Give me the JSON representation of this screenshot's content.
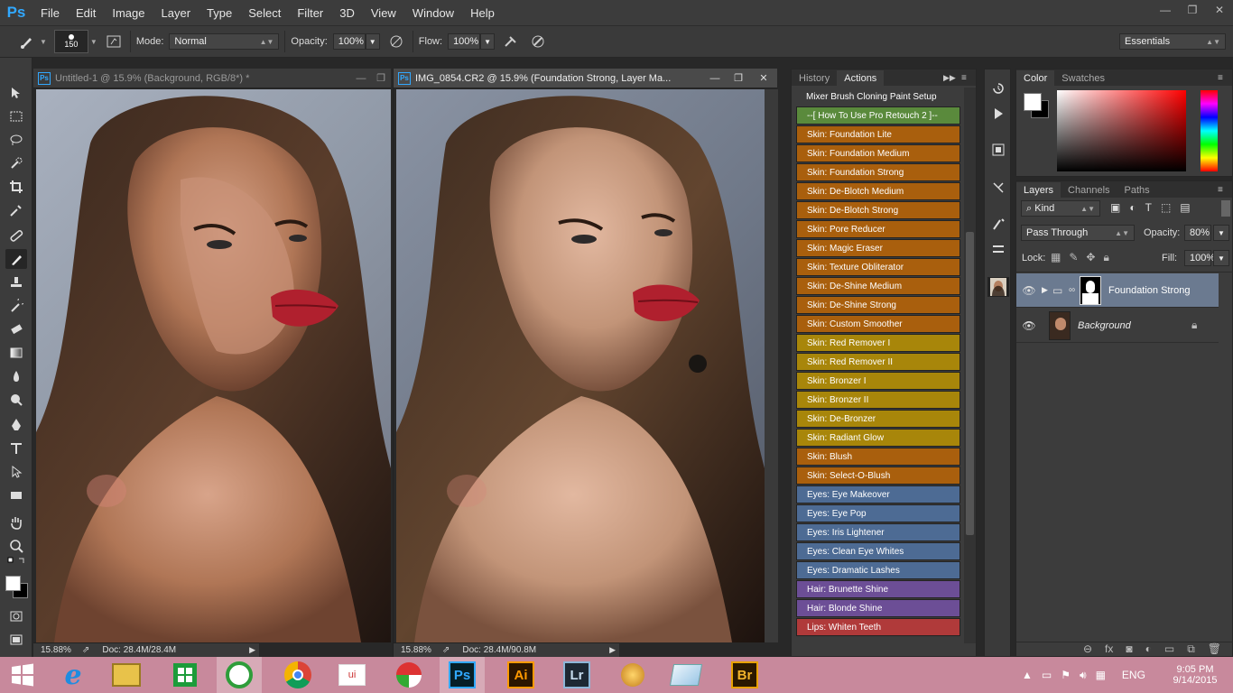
{
  "app": {
    "logo": "Ps"
  },
  "menu": [
    "File",
    "Edit",
    "Image",
    "Layer",
    "Type",
    "Select",
    "Filter",
    "3D",
    "View",
    "Window",
    "Help"
  ],
  "window_controls": {
    "minimize": "—",
    "restore": "❐",
    "close": "✕"
  },
  "options": {
    "brush_size": "150",
    "mode_label": "Mode:",
    "mode_value": "Normal",
    "opacity_label": "Opacity:",
    "opacity_value": "100%",
    "flow_label": "Flow:",
    "flow_value": "100%",
    "workspace": "Essentials"
  },
  "documents": [
    {
      "title": "Untitled-1 @ 15.9% (Background, RGB/8*) *",
      "zoom": "15.88%",
      "doc": "Doc: 28.4M/28.4M"
    },
    {
      "title": "IMG_0854.CR2 @ 15.9% (Foundation Strong, Layer Ma...",
      "zoom": "15.88%",
      "doc": "Doc: 28.4M/90.8M"
    }
  ],
  "actions_panel": {
    "tabs": [
      "History",
      "Actions"
    ],
    "active_tab": "Actions",
    "items": [
      {
        "label": "Mixer Brush Cloning Paint Setup",
        "color": "#3c3c3c"
      },
      {
        "label": "--[ How To Use Pro Retouch 2 ]--",
        "color": "#5a8a3c"
      },
      {
        "label": "Skin: Foundation Lite",
        "color": "#a95f0d"
      },
      {
        "label": "Skin: Foundation Medium",
        "color": "#a95f0d"
      },
      {
        "label": "Skin: Foundation Strong",
        "color": "#a95f0d"
      },
      {
        "label": "Skin: De-Blotch Medium",
        "color": "#a95f0d"
      },
      {
        "label": "Skin: De-Blotch Strong",
        "color": "#a95f0d"
      },
      {
        "label": "Skin: Pore Reducer",
        "color": "#a95f0d"
      },
      {
        "label": "Skin: Magic Eraser",
        "color": "#a95f0d"
      },
      {
        "label": "Skin: Texture Obliterator",
        "color": "#a95f0d"
      },
      {
        "label": "Skin: De-Shine Medium",
        "color": "#a95f0d"
      },
      {
        "label": "Skin: De-Shine Strong",
        "color": "#a95f0d"
      },
      {
        "label": "Skin: Custom Smoother",
        "color": "#a95f0d"
      },
      {
        "label": "Skin: Red Remover I",
        "color": "#a8860a"
      },
      {
        "label": "Skin: Red Remover II",
        "color": "#a8860a"
      },
      {
        "label": "Skin: Bronzer I",
        "color": "#a8860a"
      },
      {
        "label": "Skin: Bronzer II",
        "color": "#a8860a"
      },
      {
        "label": "Skin: De-Bronzer",
        "color": "#a8860a"
      },
      {
        "label": "Skin: Radiant Glow",
        "color": "#a8860a"
      },
      {
        "label": "Skin: Blush",
        "color": "#a95f0d"
      },
      {
        "label": "Skin: Select-O-Blush",
        "color": "#a95f0d"
      },
      {
        "label": "Eyes: Eye Makeover",
        "color": "#4d6b94"
      },
      {
        "label": "Eyes: Eye Pop",
        "color": "#4d6b94"
      },
      {
        "label": "Eyes: Iris Lightener",
        "color": "#4d6b94"
      },
      {
        "label": "Eyes: Clean Eye Whites",
        "color": "#4d6b94"
      },
      {
        "label": "Eyes: Dramatic Lashes",
        "color": "#4d6b94"
      },
      {
        "label": "Hair: Brunette Shine",
        "color": "#6c4e96"
      },
      {
        "label": "Hair: Blonde Shine",
        "color": "#6c4e96"
      },
      {
        "label": "Lips: Whiten Teeth",
        "color": "#b03a3a"
      }
    ]
  },
  "color_panel": {
    "tabs": [
      "Color",
      "Swatches"
    ],
    "active_tab": "Color"
  },
  "layers_panel": {
    "tabs": [
      "Layers",
      "Channels",
      "Paths"
    ],
    "active_tab": "Layers",
    "filter": "Kind",
    "blend_mode": "Pass Through",
    "opacity_label": "Opacity:",
    "opacity_value": "80%",
    "lock_label": "Lock:",
    "fill_label": "Fill:",
    "fill_value": "100%",
    "layers": [
      {
        "name": "Foundation Strong",
        "type": "group",
        "selected": true
      },
      {
        "name": "Background",
        "type": "image",
        "selected": false
      }
    ]
  },
  "taskbar": {
    "apps": [
      "ie",
      "explorer",
      "store",
      "greenshot",
      "chrome",
      "app",
      "paint",
      "photoshop",
      "illustrator",
      "lightroom",
      "flash",
      "notes",
      "bridge"
    ],
    "active": "photoshop",
    "labels": {
      "photoshop": "Ps",
      "illustrator": "Ai",
      "lightroom": "Lr",
      "bridge": "Br"
    },
    "language": "ENG",
    "time": "9:05 PM",
    "date": "9/14/2015"
  }
}
